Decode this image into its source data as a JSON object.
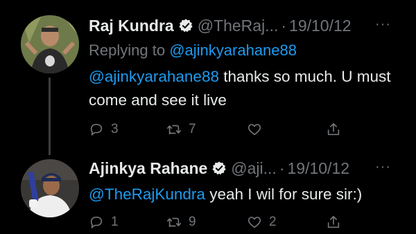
{
  "tweets": [
    {
      "name": "Raj Kundra",
      "handle": "@TheRaj...",
      "date": "19/10/12",
      "replying_label": "Replying to",
      "replying_to": "@ajinkyarahane88",
      "mention": "@ajinkyarahane88",
      "text": " thanks so much. U must come and see it live",
      "replies": "3",
      "retweets": "7",
      "likes": "",
      "more": "···"
    },
    {
      "name": "Ajinkya Rahane",
      "handle": "@aji...",
      "date": "19/10/12",
      "mention": "@TheRajKundra",
      "text": " yeah I wil for sure sir:)",
      "replies": "1",
      "retweets": "9",
      "likes": "2",
      "more": "···"
    }
  ],
  "separator": "·",
  "colors": {
    "background": "#000000",
    "text": "#e7e9ea",
    "muted": "#71767b",
    "accent": "#1d9bf0"
  },
  "icons": [
    "verified-badge-icon",
    "reply-icon",
    "retweet-icon",
    "like-icon",
    "share-icon",
    "more-icon"
  ]
}
